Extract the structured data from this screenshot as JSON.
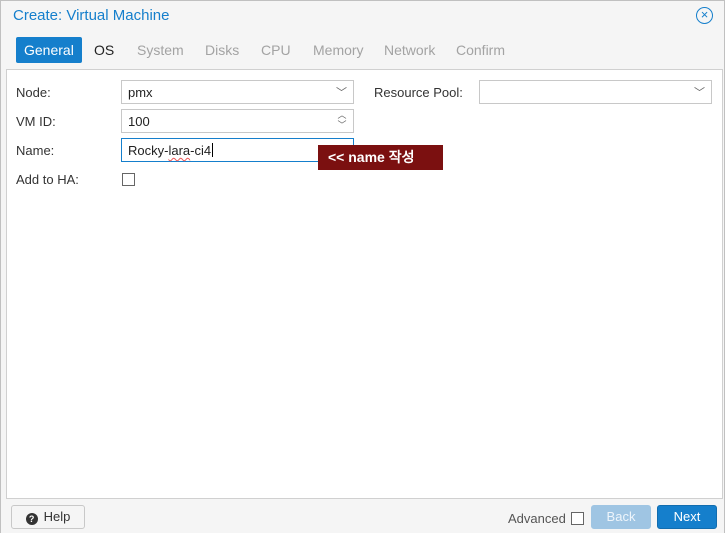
{
  "dialog": {
    "title": "Create: Virtual Machine",
    "close_icon": "close-circle-icon"
  },
  "tabs": [
    {
      "label": "General",
      "state": "active"
    },
    {
      "label": "OS",
      "state": "enabled"
    },
    {
      "label": "System",
      "state": "disabled"
    },
    {
      "label": "Disks",
      "state": "disabled"
    },
    {
      "label": "CPU",
      "state": "disabled"
    },
    {
      "label": "Memory",
      "state": "disabled"
    },
    {
      "label": "Network",
      "state": "disabled"
    },
    {
      "label": "Confirm",
      "state": "disabled"
    }
  ],
  "form": {
    "node_label": "Node:",
    "node_value": "pmx",
    "resource_pool_label": "Resource Pool:",
    "resource_pool_value": "",
    "vmid_label": "VM ID:",
    "vmid_value": "100",
    "name_label": "Name:",
    "name_value": "Rocky-lara-ci4",
    "name_value_prefix": "Rocky-",
    "name_value_underlined": "lara",
    "name_value_suffix": "-ci4",
    "ha_label": "Add to HA:",
    "ha_checked": false
  },
  "annotation": {
    "text": "<< name 작성"
  },
  "footer": {
    "help_label": "Help",
    "advanced_label": "Advanced",
    "advanced_checked": false,
    "back_label": "Back",
    "next_label": "Next"
  },
  "colors": {
    "accent": "#157fcc",
    "annotation_bg": "#7b1010",
    "disabled_button": "#9fc5e3"
  }
}
